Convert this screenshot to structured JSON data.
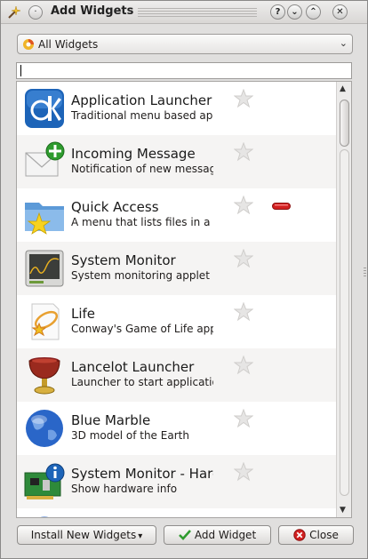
{
  "window": {
    "title": "Add Widgets"
  },
  "titlebar_buttons": {
    "help": "?",
    "minimize": "⌄",
    "maximize": "⌃",
    "close": "✕",
    "menu": "·"
  },
  "filter": {
    "selected": "All Widgets",
    "arrow": "⌄"
  },
  "search": {
    "value": "",
    "placeholder": ""
  },
  "widgets": [
    {
      "name": "Application Launcher",
      "description": "Traditional menu based application launcher",
      "icon": "kde-logo-icon",
      "in_use": false
    },
    {
      "name": "Incoming Message",
      "description": "Notification of new messages",
      "icon": "envelope-add-icon",
      "in_use": false
    },
    {
      "name": "Quick Access",
      "description": "A menu that lists files in a folder",
      "icon": "folder-star-icon",
      "in_use": true
    },
    {
      "name": "System Monitor",
      "description": "System monitoring applet",
      "icon": "monitor-graph-icon",
      "in_use": false
    },
    {
      "name": "Life",
      "description": " Conway's Game of Life applet",
      "icon": "life-icon",
      "in_use": false
    },
    {
      "name": "Lancelot Launcher",
      "description": "Launcher to start applications",
      "icon": "grail-icon",
      "in_use": false
    },
    {
      "name": "Blue Marble",
      "description": "3D model of the Earth",
      "icon": "globe-icon",
      "in_use": false
    },
    {
      "name": "System Monitor - Hardware Info",
      "description": "Show hardware info",
      "icon": "circuit-board-info-icon",
      "in_use": false
    }
  ],
  "buttons": {
    "install": "Install New Widgets",
    "add": "Add Widget",
    "close": "Close"
  },
  "colors": {
    "accent_green": "#2e9b2e",
    "remove_red": "#d21f1f",
    "globe_blue": "#2a66c8"
  }
}
